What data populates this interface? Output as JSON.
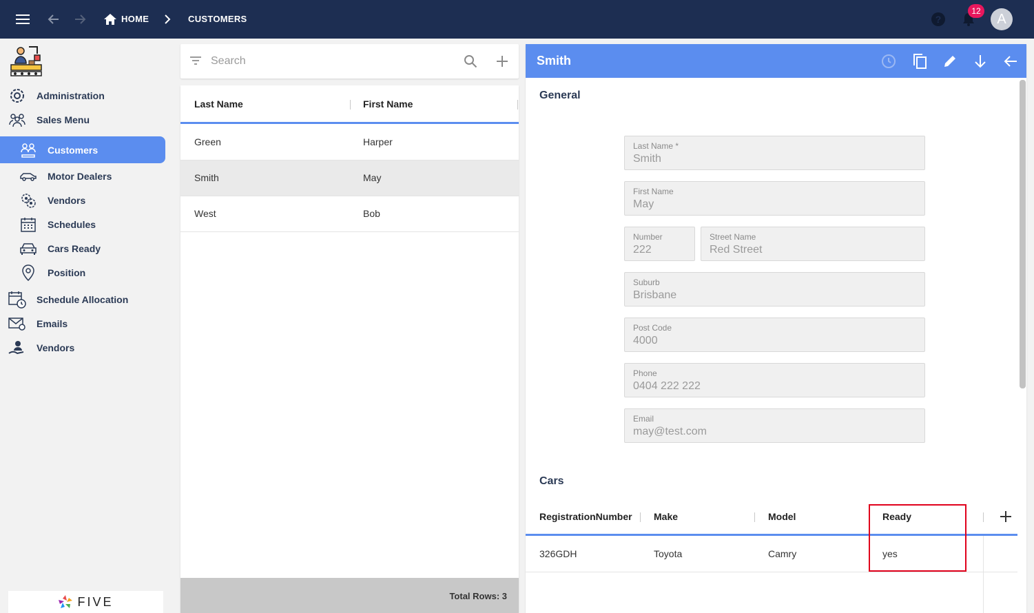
{
  "topbar": {
    "breadcrumb_home": "HOME",
    "breadcrumb_current": "CUSTOMERS",
    "notification_count": "12",
    "avatar_initial": "A"
  },
  "sidebar": {
    "items": [
      {
        "label": "Administration",
        "icon": "gear-icon"
      },
      {
        "label": "Sales Menu",
        "icon": "people-group-icon"
      },
      {
        "label": "Customers",
        "icon": "customers-icon",
        "active": true
      },
      {
        "label": "Motor Dealers",
        "icon": "car-icon"
      },
      {
        "label": "Vendors",
        "icon": "gears-icon"
      },
      {
        "label": "Schedules",
        "icon": "calendar-icon"
      },
      {
        "label": "Cars Ready",
        "icon": "car-front-icon"
      },
      {
        "label": "Position",
        "icon": "location-pin-icon"
      },
      {
        "label": "Schedule Allocation",
        "icon": "calendar-clock-icon"
      },
      {
        "label": "Emails",
        "icon": "email-icon"
      },
      {
        "label": "Vendors",
        "icon": "vendor-hand-icon"
      }
    ],
    "footer_logo": "FIVE"
  },
  "list": {
    "search_placeholder": "Search",
    "columns": [
      "Last Name",
      "First Name"
    ],
    "rows": [
      {
        "last": "Green",
        "first": "Harper"
      },
      {
        "last": "Smith",
        "first": "May",
        "selected": true
      },
      {
        "last": "West",
        "first": "Bob"
      }
    ],
    "total_rows": "Total Rows: 3"
  },
  "detail": {
    "title": "Smith",
    "general_title": "General",
    "fields": {
      "last_name": {
        "label": "Last Name *",
        "value": "Smith"
      },
      "first_name": {
        "label": "First Name",
        "value": "May"
      },
      "number": {
        "label": "Number",
        "value": "222"
      },
      "street_name": {
        "label": "Street Name",
        "value": "Red Street"
      },
      "suburb": {
        "label": "Suburb",
        "value": "Brisbane"
      },
      "post_code": {
        "label": "Post Code",
        "value": "4000"
      },
      "phone": {
        "label": "Phone",
        "value": "0404 222 222"
      },
      "email": {
        "label": "Email",
        "value": "may@test.com"
      }
    },
    "cars_title": "Cars",
    "cars_columns": [
      "RegistrationNumber",
      "Make",
      "Model",
      "Ready"
    ],
    "cars_rows": [
      {
        "registration": "326GDH",
        "make": "Toyota",
        "model": "Camry",
        "ready": "yes"
      }
    ]
  },
  "colors": {
    "topbar": "#1d2e52",
    "accent": "#5b8def",
    "badge": "#e8175d",
    "highlight_box": "#e0001b"
  }
}
